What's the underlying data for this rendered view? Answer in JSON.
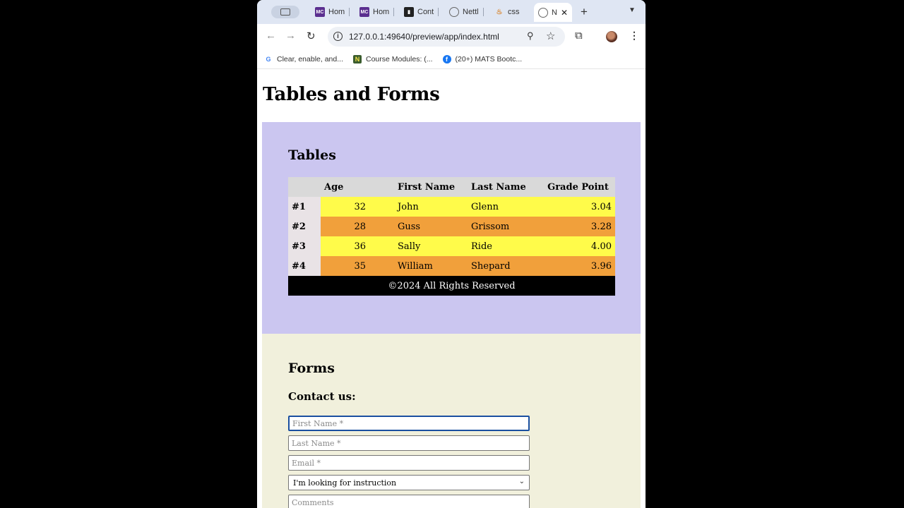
{
  "browser": {
    "tabs": [
      {
        "title": "Hom",
        "favicon": "mc-logo-icon"
      },
      {
        "title": "Hom",
        "favicon": "mc-logo-icon"
      },
      {
        "title": "Cont",
        "favicon": "bar-chart-icon"
      },
      {
        "title": "Nettl",
        "favicon": "globe-icon"
      },
      {
        "title": "css",
        "favicon": "css-icon"
      },
      {
        "title": "N",
        "favicon": "globe-icon",
        "active": true
      }
    ],
    "url": "127.0.0.1:49640/preview/app/index.html",
    "bookmarks": [
      {
        "label": "Clear, enable, and...",
        "favicon": "google-icon"
      },
      {
        "label": "Course Modules: (...",
        "favicon": "notion-icon"
      },
      {
        "label": "(20+) MATS Bootc...",
        "favicon": "facebook-icon"
      }
    ]
  },
  "page": {
    "title": "Tables and Forms",
    "tables_section": {
      "heading": "Tables",
      "columns": [
        "Age",
        "First Name",
        "Last Name",
        "Grade Point"
      ],
      "rows": [
        {
          "label": "#1",
          "age": "32",
          "first": "John",
          "last": "Glenn",
          "gpa": "3.04"
        },
        {
          "label": "#2",
          "age": "28",
          "first": "Guss",
          "last": "Grissom",
          "gpa": "3.28"
        },
        {
          "label": "#3",
          "age": "36",
          "first": "Sally",
          "last": "Ride",
          "gpa": "4.00"
        },
        {
          "label": "#4",
          "age": "35",
          "first": "William",
          "last": "Shepard",
          "gpa": "3.96"
        }
      ],
      "footer": "©2024 All Rights Reserved"
    },
    "forms_section": {
      "heading": "Forms",
      "subheading": "Contact us:",
      "first_name_placeholder": "First Name *",
      "last_name_placeholder": "Last Name *",
      "email_placeholder": "Email *",
      "select_value": "I'm looking for instruction",
      "comments_placeholder": "Comments"
    }
  },
  "colors": {
    "tables_bg": "#cbc6f0",
    "forms_bg": "#f1f0dc",
    "row_yellow": "#fffb4a",
    "row_orange": "#f1a03b"
  }
}
